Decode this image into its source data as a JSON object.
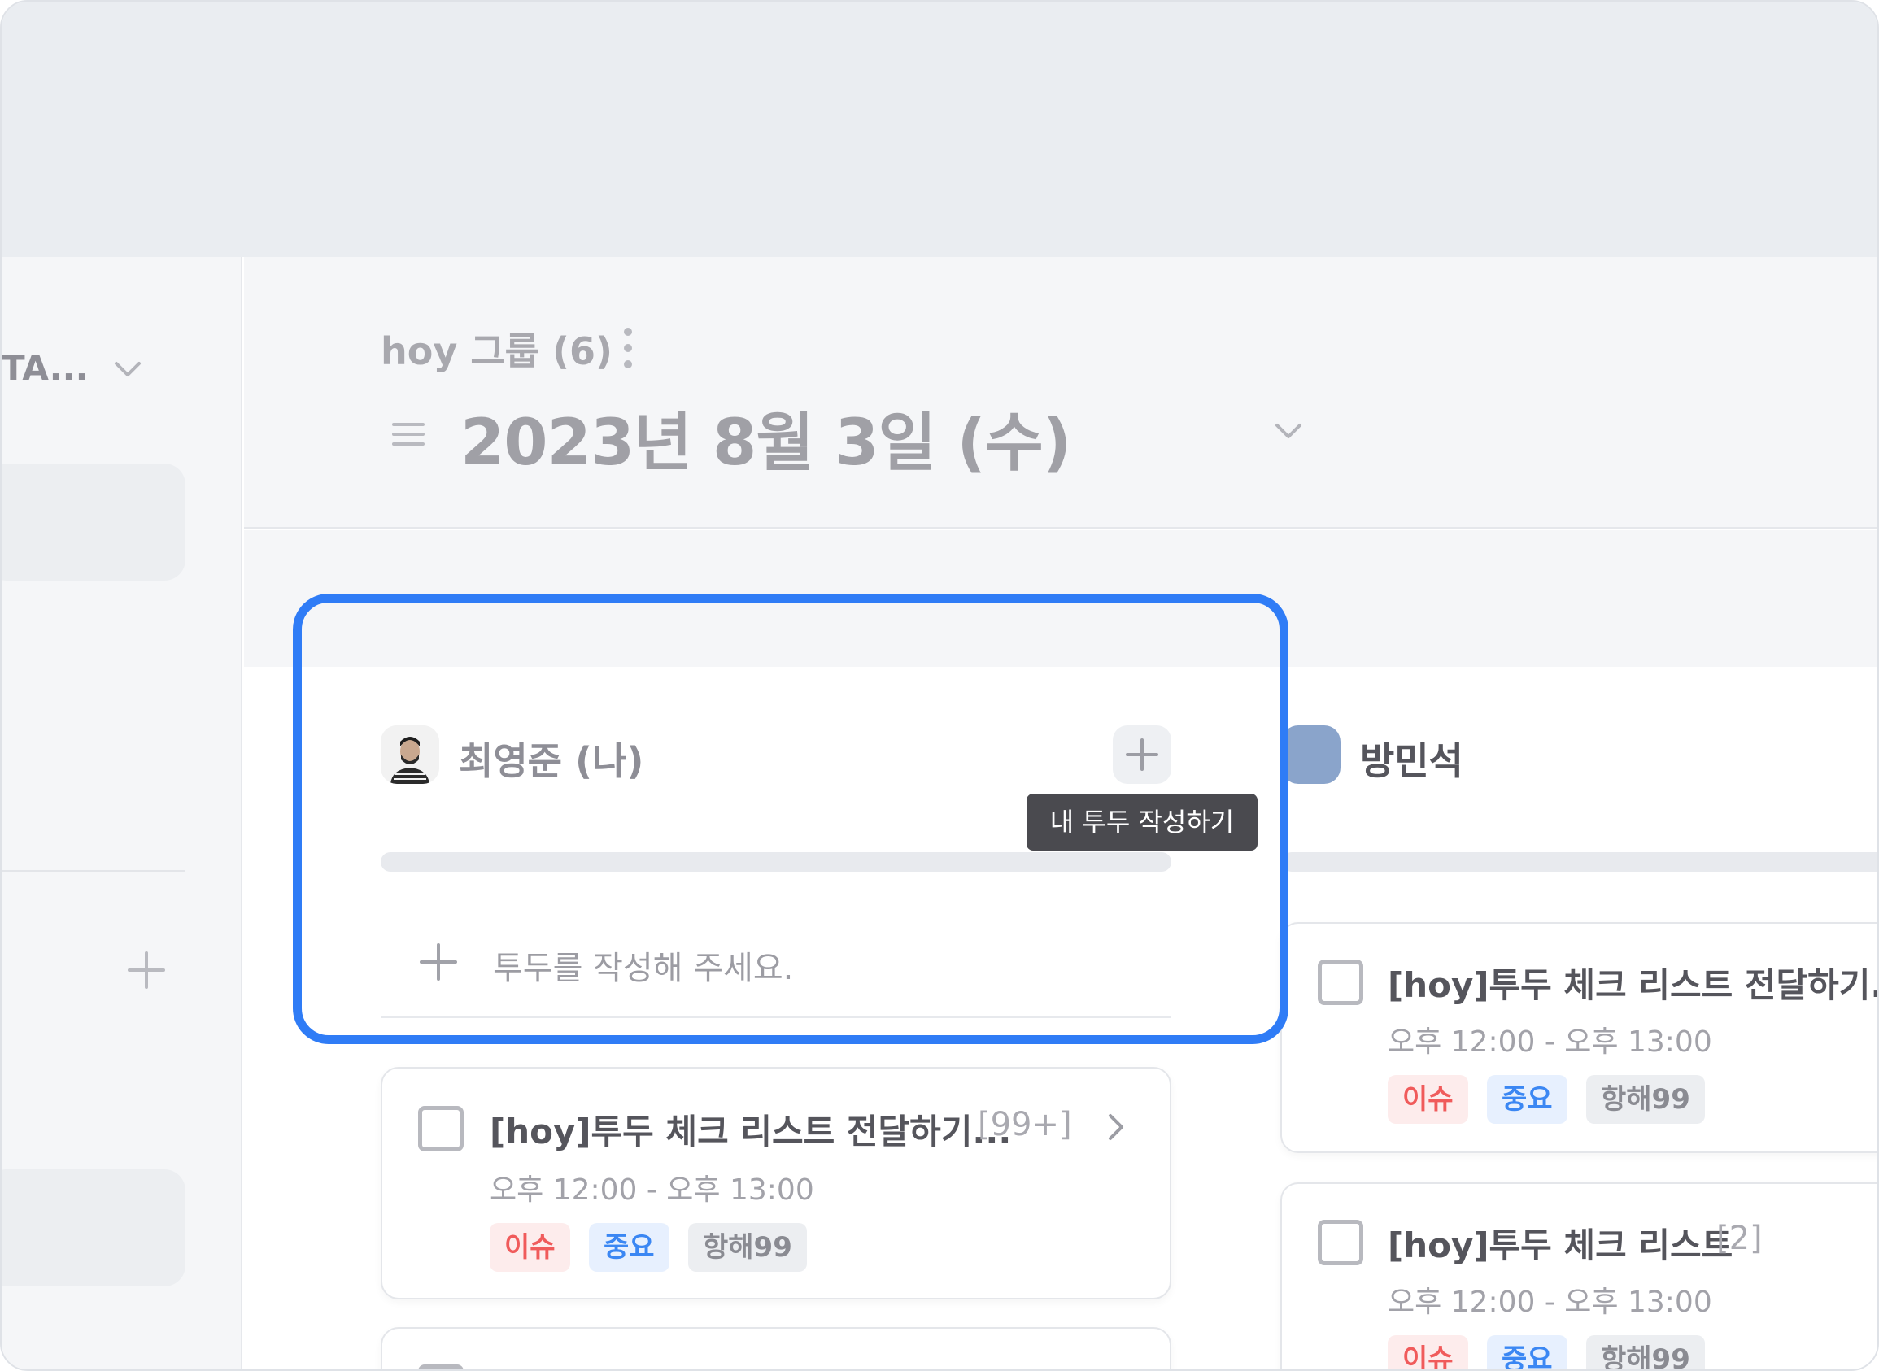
{
  "sidebar": {
    "workspace_name": "TA...",
    "icons": [
      "chevron-down-icon",
      "plus-icon"
    ]
  },
  "header": {
    "group_title": "hoy 그룹 (6)",
    "date_title": "2023년 8월 3일 (수)"
  },
  "colors": {
    "highlight": "#2f7cf6",
    "tooltip_bg": "#4a4a4f",
    "tag_issue": "#f05b5b",
    "tag_important": "#3b87f3",
    "avatar_placeholder": "#8aa4cb"
  },
  "members": [
    {
      "name": "최영준 (나)",
      "add_tooltip": "내 투두 작성하기",
      "input_placeholder": "투두를 작성해 주세요.",
      "todos": [
        {
          "title": "[hoy]투두 체크 리스트 전달하기...",
          "count": "[99+]",
          "time": "오후 12:00 - 오후 13:00",
          "tags": [
            "이슈",
            "중요",
            "항해99"
          ]
        }
      ]
    },
    {
      "name": "방민석",
      "todos": [
        {
          "title": "[hoy]투두 체크 리스트 전달하기...",
          "time": "오후 12:00 - 오후 13:00",
          "tags": [
            "이슈",
            "중요",
            "항해99"
          ]
        },
        {
          "title": "[hoy]투두 체크 리스트",
          "count": "[2]",
          "time": "오후 12:00 - 오후 13:00",
          "tags": [
            "이슈",
            "중요",
            "항해99"
          ]
        }
      ]
    }
  ]
}
